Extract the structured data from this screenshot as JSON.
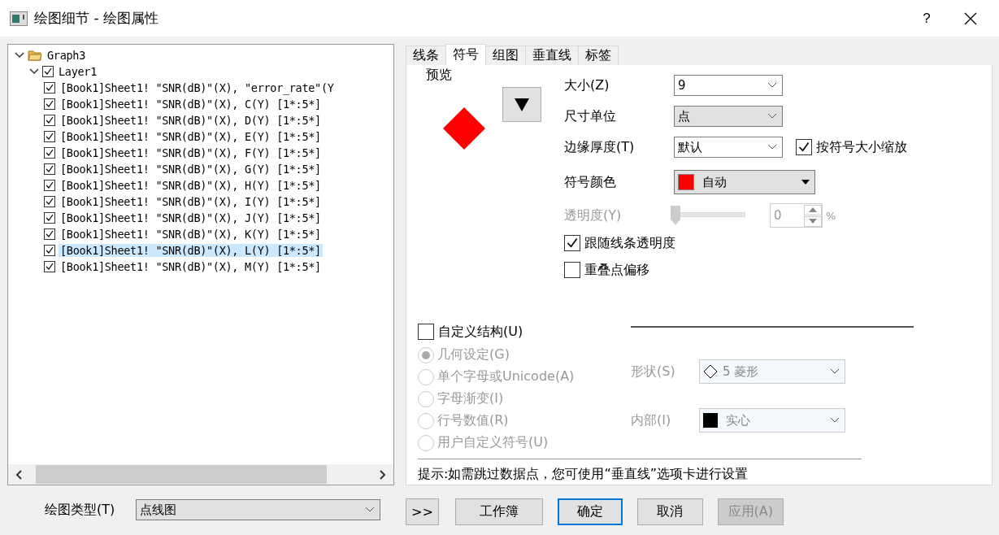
{
  "window": {
    "title": "绘图细节 - 绘图属性",
    "help": "?"
  },
  "tree": {
    "items": [
      {
        "label": "Graph3",
        "expanded": true,
        "children": [
          {
            "label": "Layer1",
            "checked": true,
            "expanded": true,
            "children": [
              {
                "label": "[Book1]Sheet1! \"SNR(dB)\"(X), \"error_rate\"(Y",
                "checked": true,
                "selected": false
              },
              {
                "label": "[Book1]Sheet1! \"SNR(dB)\"(X), C(Y) [1*:5*]",
                "checked": true,
                "selected": false
              },
              {
                "label": "[Book1]Sheet1! \"SNR(dB)\"(X), D(Y) [1*:5*]",
                "checked": true,
                "selected": false
              },
              {
                "label": "[Book1]Sheet1! \"SNR(dB)\"(X), E(Y) [1*:5*]",
                "checked": true,
                "selected": false
              },
              {
                "label": "[Book1]Sheet1! \"SNR(dB)\"(X), F(Y) [1*:5*]",
                "checked": true,
                "selected": false
              },
              {
                "label": "[Book1]Sheet1! \"SNR(dB)\"(X), G(Y) [1*:5*]",
                "checked": true,
                "selected": false
              },
              {
                "label": "[Book1]Sheet1! \"SNR(dB)\"(X), H(Y) [1*:5*]",
                "checked": true,
                "selected": false
              },
              {
                "label": "[Book1]Sheet1! \"SNR(dB)\"(X), I(Y) [1*:5*]",
                "checked": true,
                "selected": false
              },
              {
                "label": "[Book1]Sheet1! \"SNR(dB)\"(X), J(Y) [1*:5*]",
                "checked": true,
                "selected": false
              },
              {
                "label": "[Book1]Sheet1! \"SNR(dB)\"(X), K(Y) [1*:5*]",
                "checked": true,
                "selected": false
              },
              {
                "label": "[Book1]Sheet1! \"SNR(dB)\"(X), L(Y) [1*:5*]",
                "checked": true,
                "selected": true
              },
              {
                "label": "[Book1]Sheet1! \"SNR(dB)\"(X), M(Y) [1*:5*]",
                "checked": true,
                "selected": false
              }
            ]
          }
        ]
      }
    ]
  },
  "plot_type": {
    "label": "绘图类型(T)",
    "value": "点线图"
  },
  "tabs": [
    {
      "label": "线条",
      "selected": false
    },
    {
      "label": "符号",
      "selected": true
    },
    {
      "label": "组图",
      "selected": false
    },
    {
      "label": "垂直线",
      "selected": false
    },
    {
      "label": "标签",
      "selected": false
    }
  ],
  "symbol": {
    "preview_label": "预览",
    "size": {
      "label": "大小(Z)",
      "value": "9"
    },
    "size_unit": {
      "label": "尺寸单位",
      "value": "点"
    },
    "edge_thickness": {
      "label": "边缘厚度(T)",
      "value": "默认"
    },
    "scale_with_size": {
      "label": "按符号大小缩放",
      "checked": true
    },
    "color": {
      "label": "符号颜色",
      "value": "自动",
      "color": "#ff0000"
    },
    "transparency": {
      "label": "透明度(Y)",
      "value": "0",
      "unit": "%",
      "level": 0,
      "disabled": true
    },
    "follow_line_transparency": {
      "label": "跟随线条透明度",
      "checked": true
    },
    "offset_overlap": {
      "label": "重叠点偏移",
      "checked": false
    },
    "custom_construction": {
      "label": "自定义结构(U)",
      "checked": false
    },
    "radios": [
      {
        "label": "几何设定(G)",
        "selected": true,
        "disabled": true
      },
      {
        "label": "单个字母或Unicode(A)",
        "selected": false,
        "disabled": true
      },
      {
        "label": "字母渐变(I)",
        "selected": false,
        "disabled": true
      },
      {
        "label": "行号数值(R)",
        "selected": false,
        "disabled": true
      },
      {
        "label": "用户自定义符号(U)",
        "selected": false,
        "disabled": true
      }
    ],
    "shape": {
      "label": "形状(S)",
      "value": "5 菱形",
      "disabled": true
    },
    "interior": {
      "label": "内部(I)",
      "value": "实心",
      "disabled": true
    },
    "hint": "提示:如需跳过数据点，您可使用“垂直线”选项卡进行设置"
  },
  "buttons": [
    {
      "label": ">>",
      "default": false,
      "disabled": false
    },
    {
      "label": "工作簿",
      "default": false,
      "disabled": false
    },
    {
      "label": "确定",
      "default": true,
      "disabled": false
    },
    {
      "label": "取消",
      "default": false,
      "disabled": false
    },
    {
      "label": "应用(A)",
      "default": false,
      "disabled": true
    }
  ]
}
